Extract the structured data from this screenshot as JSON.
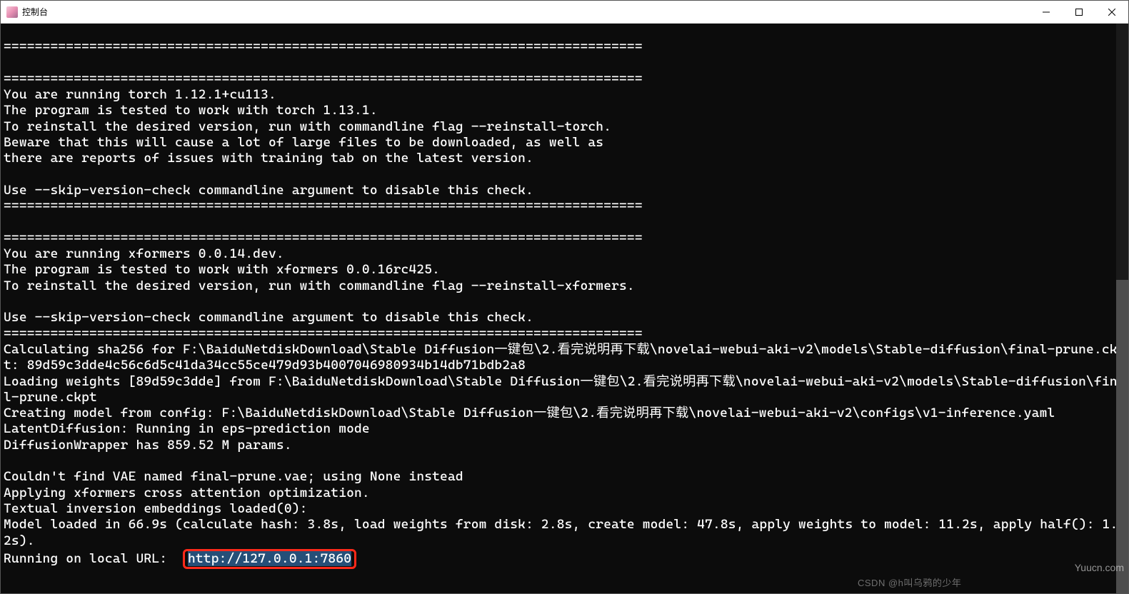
{
  "window": {
    "title": "控制台",
    "controls": {
      "minimize": "—",
      "maximize": "□",
      "close": "✕"
    }
  },
  "terminal": {
    "lines": [
      "",
      "==================================================================================",
      "",
      "==================================================================================",
      "You are running torch 1.12.1+cu113.",
      "The program is tested to work with torch 1.13.1.",
      "To reinstall the desired version, run with commandline flag --reinstall-torch.",
      "Beware that this will cause a lot of large files to be downloaded, as well as",
      "there are reports of issues with training tab on the latest version.",
      "",
      "Use --skip-version-check commandline argument to disable this check.",
      "==================================================================================",
      "",
      "==================================================================================",
      "You are running xformers 0.0.14.dev.",
      "The program is tested to work with xformers 0.0.16rc425.",
      "To reinstall the desired version, run with commandline flag --reinstall-xformers.",
      "",
      "Use --skip-version-check commandline argument to disable this check.",
      "==================================================================================",
      "Calculating sha256 for F:\\BaiduNetdiskDownload\\Stable Diffusion一键包\\2.看完说明再下载\\novelai-webui-aki-v2\\models\\Stable-diffusion\\final-prune.ckpt: 89d59c3dde4c56c6d5c41da34cc55ce479d93b4007046980934b14db71bdb2a8",
      "Loading weights [89d59c3dde] from F:\\BaiduNetdiskDownload\\Stable Diffusion一键包\\2.看完说明再下载\\novelai-webui-aki-v2\\models\\Stable-diffusion\\final-prune.ckpt",
      "Creating model from config: F:\\BaiduNetdiskDownload\\Stable Diffusion一键包\\2.看完说明再下载\\novelai-webui-aki-v2\\configs\\v1-inference.yaml",
      "LatentDiffusion: Running in eps-prediction mode",
      "DiffusionWrapper has 859.52 M params.",
      "",
      "Couldn't find VAE named final-prune.vae; using None instead",
      "Applying xformers cross attention optimization.",
      "Textual inversion embeddings loaded(0):",
      "Model loaded in 66.9s (calculate hash: 3.8s, load weights from disk: 2.8s, create model: 47.8s, apply weights to model: 11.2s, apply half(): 1.2s)."
    ],
    "url_line_prefix": "Running on local URL:  ",
    "url": "http://127.0.0.1:7860"
  },
  "scrollbar": {
    "thumb_top_pct": 45,
    "thumb_height_pct": 55
  },
  "watermark": {
    "right": "Yuucn.com",
    "bottom": "CSDN @h叫乌鸦的少年"
  }
}
